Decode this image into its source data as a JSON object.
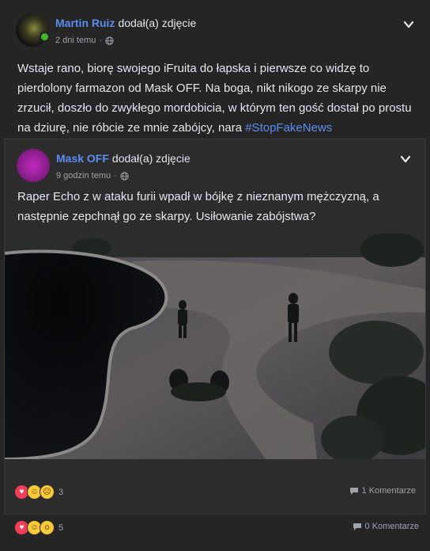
{
  "post": {
    "author": "Martin Ruiz",
    "action": "dodał(a) zdjęcie",
    "time": "2 dni temu",
    "text": "Wstaje rano, biorę swojego iFruita do łapska i pierwsze co widzę to pierdolony farmazon od Mask OFF. Na boga, nikt nikogo ze skarpy nie zrzucił, doszło do zwykłego mordobicia, w którym ten gość dostał po prostu na dziurę, nie róbcie ze mnie zabójcy, nara ",
    "hashtag": "#StopFakeNews",
    "reactions_count": "5",
    "comments": "0 Komentarze"
  },
  "shared": {
    "author": "Mask OFF",
    "action": "dodał(a) zdjęcie",
    "time": "9 godzin temu",
    "text": "Raper Echo z w ataku furii wpadł w bójkę z nieznanym mężczyzną, a następnie zepchnął go ze skarpy. Usiłowanie zabójstwa?",
    "reactions_count": "3",
    "comments": "1 Komentarze"
  },
  "icons": {
    "privacy": "globe-icon",
    "menu": "chevron-down-icon",
    "comment": "comment-icon"
  },
  "colors": {
    "link": "#5b8def",
    "background": "#252526",
    "online": "#42b72a"
  }
}
